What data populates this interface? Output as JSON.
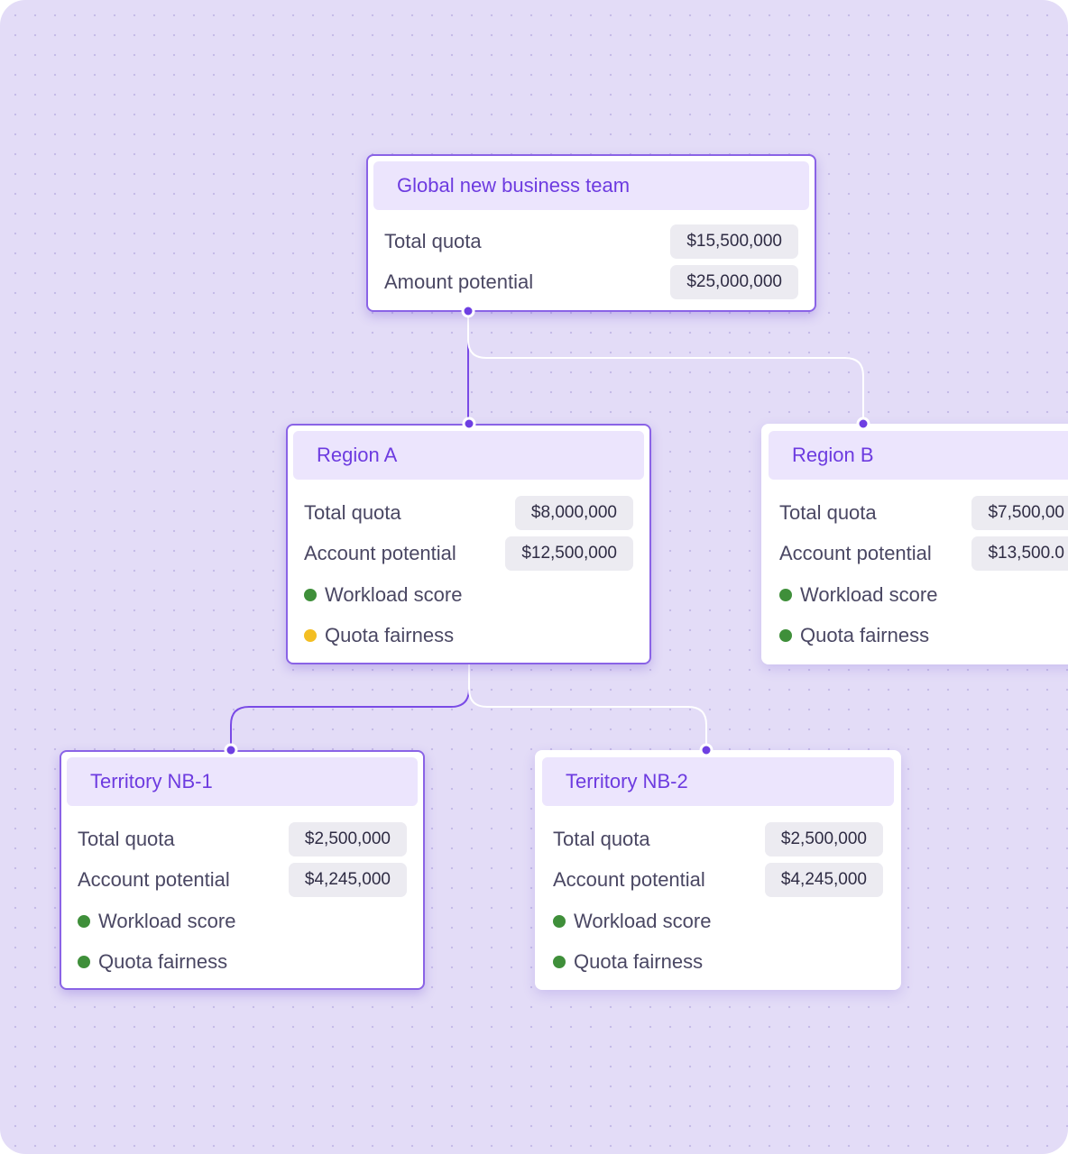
{
  "colors": {
    "accent": "#6d3be0",
    "header_bg": "#ece5fd",
    "status_good": "#3f8f3a",
    "status_warning": "#f3be23"
  },
  "global": {
    "title": "Global new business team",
    "rows": [
      {
        "label": "Total quota",
        "value": "$15,500,000"
      },
      {
        "label": "Amount potential",
        "value": "$25,000,000"
      }
    ]
  },
  "region_a": {
    "title": "Region A",
    "rows": [
      {
        "label": "Total quota",
        "value": "$8,000,000"
      },
      {
        "label": "Account potential",
        "value": "$12,500,000"
      }
    ],
    "metrics": [
      {
        "label": "Workload score",
        "status": "good"
      },
      {
        "label": "Quota fairness",
        "status": "warning"
      }
    ]
  },
  "region_b": {
    "title": "Region B",
    "rows": [
      {
        "label": "Total quota",
        "value": "$7,500,00"
      },
      {
        "label": "Account potential",
        "value": "$13,500.0"
      }
    ],
    "metrics": [
      {
        "label": "Workload score",
        "status": "good"
      },
      {
        "label": "Quota fairness",
        "status": "good"
      }
    ]
  },
  "territory_nb1": {
    "title": "Territory NB-1",
    "rows": [
      {
        "label": "Total quota",
        "value": "$2,500,000"
      },
      {
        "label": "Account potential",
        "value": "$4,245,000"
      }
    ],
    "metrics": [
      {
        "label": "Workload score",
        "status": "good"
      },
      {
        "label": "Quota fairness",
        "status": "good"
      }
    ]
  },
  "territory_nb2": {
    "title": "Territory NB-2",
    "rows": [
      {
        "label": "Total quota",
        "value": "$2,500,000"
      },
      {
        "label": "Account potential",
        "value": "$4,245,000"
      }
    ],
    "metrics": [
      {
        "label": "Workload score",
        "status": "good"
      },
      {
        "label": "Quota fairness",
        "status": "good"
      }
    ]
  }
}
